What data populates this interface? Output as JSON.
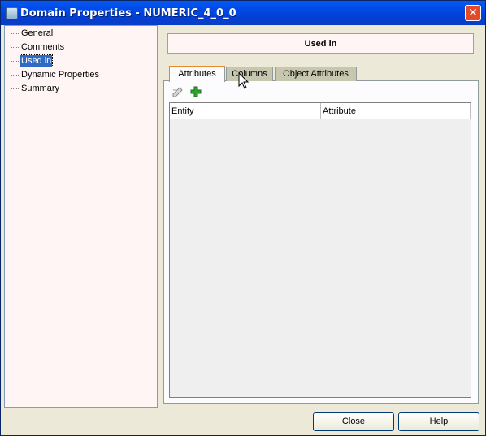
{
  "window": {
    "title": "Domain Properties - NUMERIC_4_0_0",
    "close_symbol": "✕"
  },
  "tree": {
    "items": [
      {
        "label": "General",
        "selected": false
      },
      {
        "label": "Comments",
        "selected": false
      },
      {
        "label": "Used in",
        "selected": true
      },
      {
        "label": "Dynamic Properties",
        "selected": false
      },
      {
        "label": "Summary",
        "selected": false
      }
    ]
  },
  "panel": {
    "header": "Used in",
    "tabs": [
      {
        "label": "Attributes",
        "active": true
      },
      {
        "label": "Columns",
        "active": false
      },
      {
        "label": "Object Attributes",
        "active": false
      }
    ],
    "toolbar": {
      "icons": [
        "properties-edit-icon",
        "add-icon"
      ]
    },
    "table": {
      "columns": [
        "Entity",
        "Attribute"
      ],
      "rows": []
    }
  },
  "buttons": {
    "close_prefix": "",
    "close_mnemonic": "C",
    "close_rest": "lose",
    "help_prefix": "",
    "help_mnemonic": "H",
    "help_rest": "elp"
  },
  "colors": {
    "title_bar": "#0050ee",
    "selection": "#316ac5",
    "tab_active_accent": "#e68b2c",
    "add_icon": "#2ea12e"
  }
}
